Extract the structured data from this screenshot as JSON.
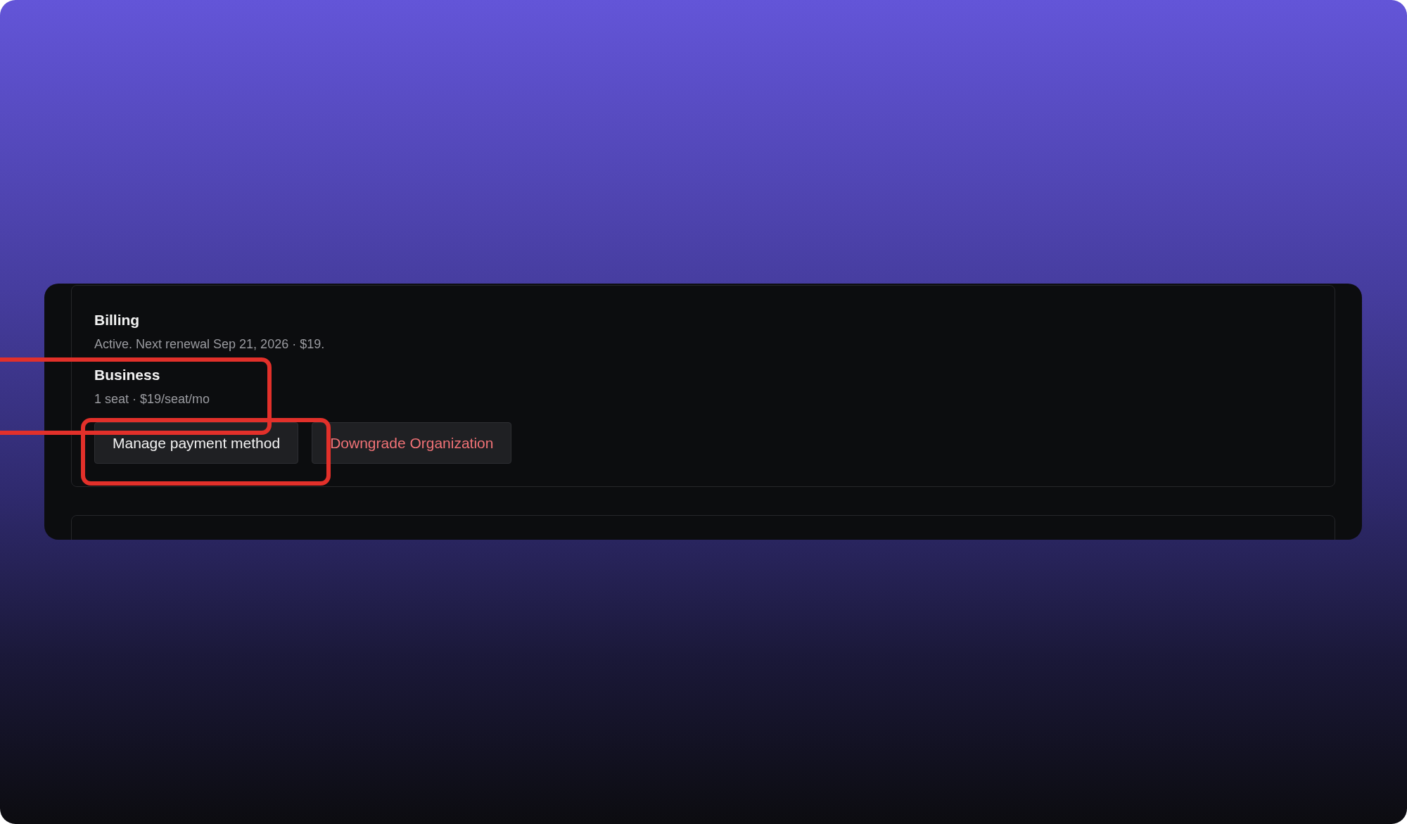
{
  "billing": {
    "title": "Billing",
    "status": "Active. Next renewal Sep 21, 2026 · $19.",
    "plan": {
      "name": "Business",
      "details": "1 seat · $19/seat/mo"
    },
    "buttons": [
      {
        "label": "Manage payment method",
        "kind": "default"
      },
      {
        "label": "Downgrade Organization",
        "kind": "danger"
      }
    ]
  }
}
